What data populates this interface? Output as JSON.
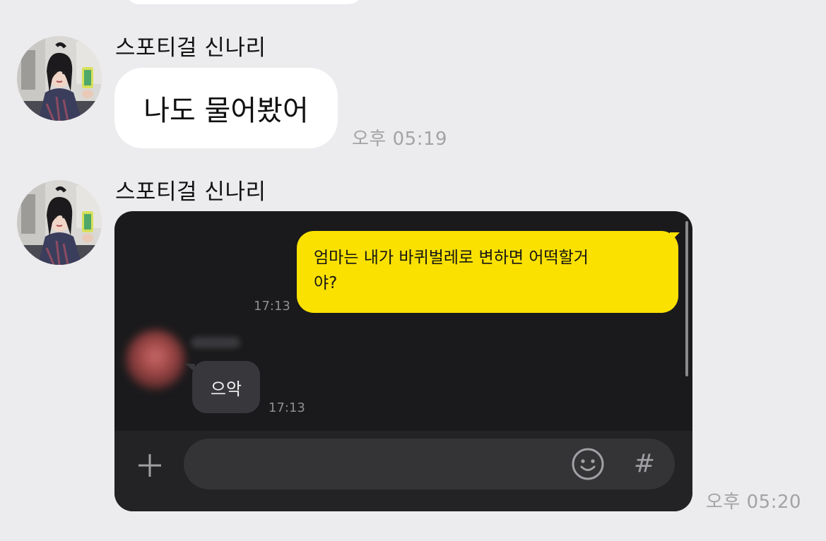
{
  "chat": {
    "messages": [
      {
        "sender": "스포티걸 신나리",
        "avatar_icon": "profile-photo",
        "text": "나도 물어봤어",
        "time": "오후 05:19"
      },
      {
        "sender": "스포티걸 신나리",
        "avatar_icon": "profile-photo",
        "attachment": "screenshot",
        "time": "오후 05:20"
      }
    ]
  },
  "screenshot": {
    "sent_message": {
      "text_line1": "엄마는 내가 바퀴벌레로 변하면 어떡할거",
      "text_line2": "야?",
      "time": "17:13"
    },
    "reply_message": {
      "text": "으악",
      "time": "17:13"
    },
    "input_bar": {
      "value": "",
      "plus_icon": "plus-icon",
      "emoji_icon": "smiley-icon",
      "hash_label": "#"
    }
  },
  "colors": {
    "background": "#ececee",
    "bubble_white": "#ffffff",
    "bubble_yellow": "#fae100",
    "dark_bg": "#1a1a1c",
    "dark_bubble": "#38383c",
    "time_gray": "#a3a3a6"
  }
}
